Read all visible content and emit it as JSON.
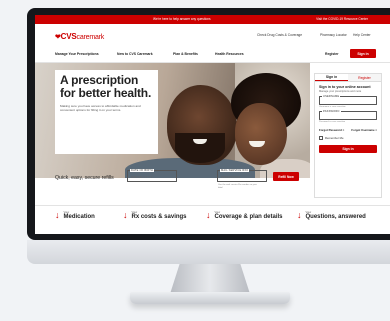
{
  "topbar": {
    "message": "We're here to help answer any questions",
    "covid_link": "Visit the COVID-19 Resource Center"
  },
  "brand": {
    "heart": "❤",
    "name": "CVS",
    "suffix": "caremark"
  },
  "utility": [
    "Check Drug Costs & Coverage",
    "Pharmacy Locator",
    "Help Center"
  ],
  "nav": [
    "Manage Your Prescriptions",
    "New to CVS Caremark",
    "Plan & Benefits",
    "Health Resources"
  ],
  "register": "Register",
  "sign_in": "Sign in",
  "hero": {
    "title": "A prescription for better health.",
    "description": "Making sure you have access to affordable medication and convenient options for filling it on your terms."
  },
  "panel": {
    "tab_signin": "Sign in",
    "tab_register": "Register",
    "title": "Sign in to your online account",
    "subtitle": "Manage your prescriptions and more",
    "username_label": "USERNAME",
    "username_hint": "Username is case sensitive",
    "password_label": "PASSWORD",
    "password_hint": "Password is case sensitive",
    "forgot_password": "Forgot Password >",
    "forgot_username": "Forgot Username >",
    "remember": "Remember Me",
    "button": "Sign in"
  },
  "refill": {
    "title": "Quick, easy, secure refills",
    "dob_label": "DATE OF BIRTH",
    "dob_placeholder": "MM/DD/YYYY",
    "rx_label": "MAIL SERVICE RX#",
    "rx_placeholder": "##########",
    "rx_hint": "Use the mail service Rx number on your label",
    "button": "Refill Now"
  },
  "jumps": [
    {
      "view": "View",
      "name": "Medication"
    },
    {
      "view": "View",
      "name": "Rx costs & savings"
    },
    {
      "view": "View",
      "name": "Coverage & plan details"
    },
    {
      "view": "View",
      "name": "Questions, answered"
    }
  ],
  "colors": {
    "brand_red": "#cc0000"
  }
}
